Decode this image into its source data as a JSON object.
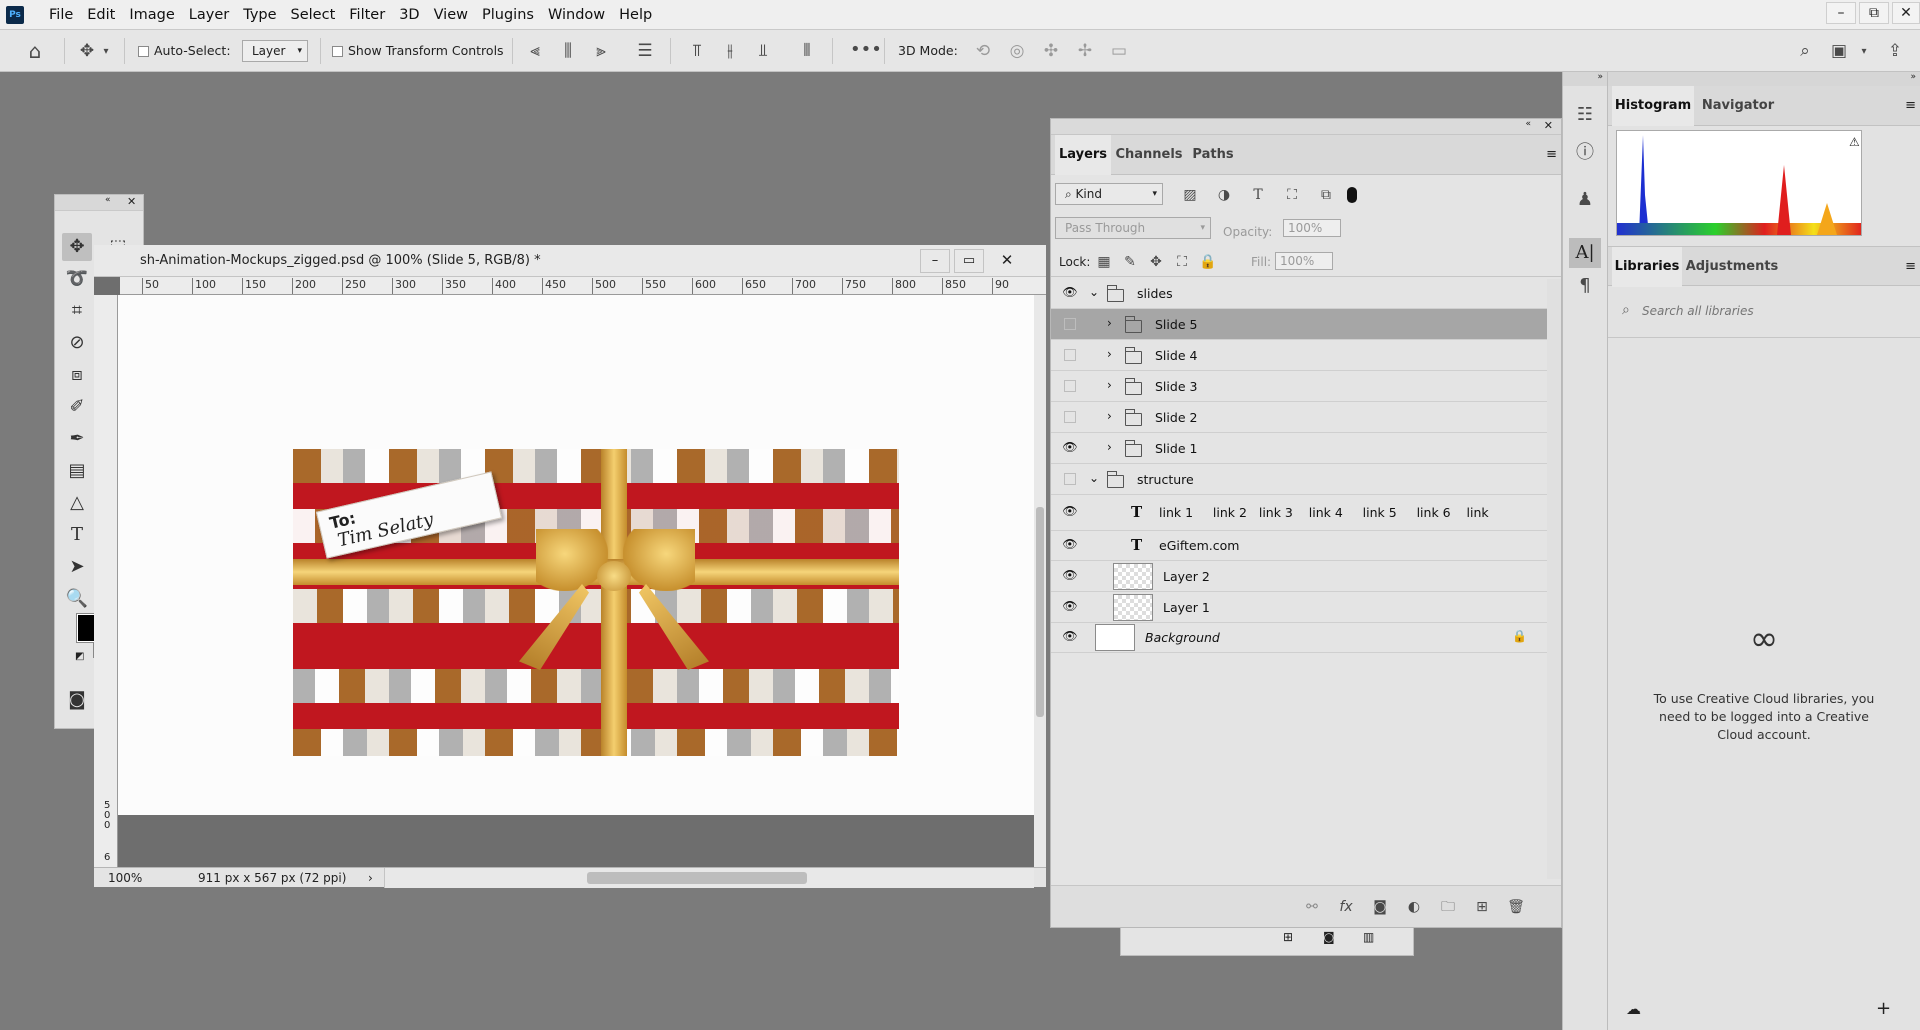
{
  "menubar": {
    "logo": "Ps",
    "items": [
      "File",
      "Edit",
      "Image",
      "Layer",
      "Type",
      "Select",
      "Filter",
      "3D",
      "View",
      "Plugins",
      "Window",
      "Help"
    ],
    "window_controls": [
      "–",
      "⧉",
      "✕"
    ]
  },
  "options": {
    "auto_select_label": "Auto-Select:",
    "auto_select_target": "Layer",
    "show_transform_label": "Show Transform Controls",
    "three_d_mode_label": "3D Mode:"
  },
  "document": {
    "title": "sh-Animation-Mockups_zigged.psd @ 100% (Slide 5, RGB/8) *",
    "zoom": "100%",
    "dimensions": "911 px x 567 px (72 ppi)",
    "ruler_h": [
      "50",
      "100",
      "150",
      "200",
      "250",
      "300",
      "350",
      "400",
      "450",
      "500",
      "550",
      "600",
      "650",
      "700",
      "750",
      "800",
      "850",
      "90"
    ],
    "ruler_v": [
      "5",
      "0",
      "0",
      "6"
    ],
    "gift_tag_to": "To:",
    "gift_tag_name": "Tim Selaty"
  },
  "layers_panel": {
    "tabs": [
      "Layers",
      "Channels",
      "Paths"
    ],
    "filter_kind": "Kind",
    "blend_mode": "Pass Through",
    "opacity_label": "Opacity:",
    "opacity_value": "100%",
    "lock_label": "Lock:",
    "fill_label": "Fill:",
    "fill_value": "100%",
    "layers": [
      {
        "name": "slides",
        "kind": "group",
        "visible": true,
        "expanded": true,
        "indent": 0
      },
      {
        "name": "Slide 5",
        "kind": "group",
        "visible": false,
        "expanded": false,
        "indent": 1,
        "selected": true
      },
      {
        "name": "Slide 4",
        "kind": "group",
        "visible": false,
        "expanded": false,
        "indent": 1
      },
      {
        "name": "Slide 3",
        "kind": "group",
        "visible": false,
        "expanded": false,
        "indent": 1
      },
      {
        "name": "Slide 2",
        "kind": "group",
        "visible": false,
        "expanded": false,
        "indent": 1
      },
      {
        "name": "Slide 1",
        "kind": "group",
        "visible": true,
        "expanded": false,
        "indent": 1
      },
      {
        "name": "structure",
        "kind": "group",
        "visible": false,
        "expanded": true,
        "indent": 0
      },
      {
        "name": "link 1     link 2   link 3    link 4     link 5     link 6    link",
        "kind": "text",
        "visible": true,
        "indent": 1
      },
      {
        "name": "eGiftem.com",
        "kind": "text",
        "visible": true,
        "indent": 1
      },
      {
        "name": "Layer 2",
        "kind": "pixel",
        "visible": true,
        "indent": 1
      },
      {
        "name": "Layer 1",
        "kind": "pixel",
        "visible": true,
        "indent": 1
      },
      {
        "name": "Background",
        "kind": "background",
        "visible": true,
        "indent": 0,
        "locked": true
      }
    ]
  },
  "right_panels": {
    "top_tabs": [
      "Histogram",
      "Navigator"
    ],
    "mid_tabs": [
      "Libraries",
      "Adjustments"
    ],
    "search_placeholder": "Search all libraries",
    "cc_message": "To use Creative Cloud libraries, you need to be logged into a Creative Cloud account."
  },
  "colors": {
    "accent_red": "#c0171f",
    "ribbon_gold": "#d9a43a",
    "selected_row": "#a6a6a6"
  }
}
